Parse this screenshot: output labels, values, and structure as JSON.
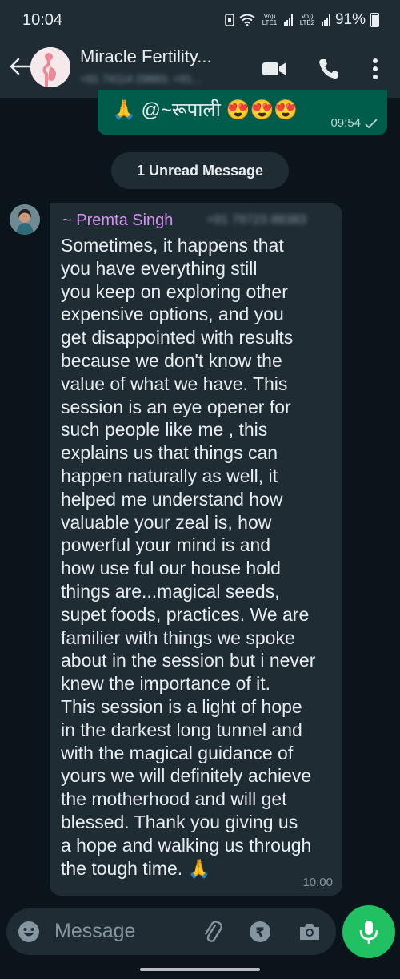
{
  "status_bar": {
    "time": "10:04",
    "sim1_volte": "Vo)) LTE1",
    "sim2_volte": "Vo)) LTE2",
    "battery": "91%"
  },
  "header": {
    "title": "Miracle Fertility...",
    "subtitle": "+91 74114 29883, +91..."
  },
  "messages": {
    "outgoing": {
      "text": "🙏 @~रूपाली 😍😍😍",
      "time": "09:54"
    },
    "unread_pill": "1 Unread Message",
    "incoming": {
      "sender": "~ Premta Singh",
      "sender_phone": "+91 79723 88383",
      "text": "Sometimes, it happens that\nyou have everything still\nyou keep on exploring other\nexpensive options, and you\nget disappointed with results\nbecause we don't know the\nvalue of what we have. This\nsession is an eye opener for\nsuch people like me , this\nexplains us that things can\nhappen naturally as well, it\nhelped me understand how\nvaluable your zeal is, how\npowerful your mind is and\nhow use ful our house hold\nthings are...magical seeds,\nsupet foods, practices. We are\nfamilier with things we spoke\nabout in the session but i never\nknew the importance of it.\nThis session is a light of hope\nin the darkest long tunnel and\nwith the magical guidance of\nyours we will definitely achieve\nthe motherhood and will get\nblessed. Thank you giving us\na hope and walking us through\nthe tough time. 🙏",
      "time": "10:00"
    }
  },
  "composer": {
    "placeholder": "Message"
  },
  "colors": {
    "accent_green": "#21c063",
    "outgoing_bubble": "#005c4b",
    "incoming_bubble": "#1f2c34",
    "sender_name": "#d98ef5",
    "background": "#0b141a"
  },
  "icons": [
    "back-arrow-icon",
    "video-call-icon",
    "voice-call-icon",
    "more-options-icon",
    "emoji-icon",
    "attach-icon",
    "rupee-payment-icon",
    "camera-icon",
    "mic-icon",
    "read-ticks-icon"
  ]
}
